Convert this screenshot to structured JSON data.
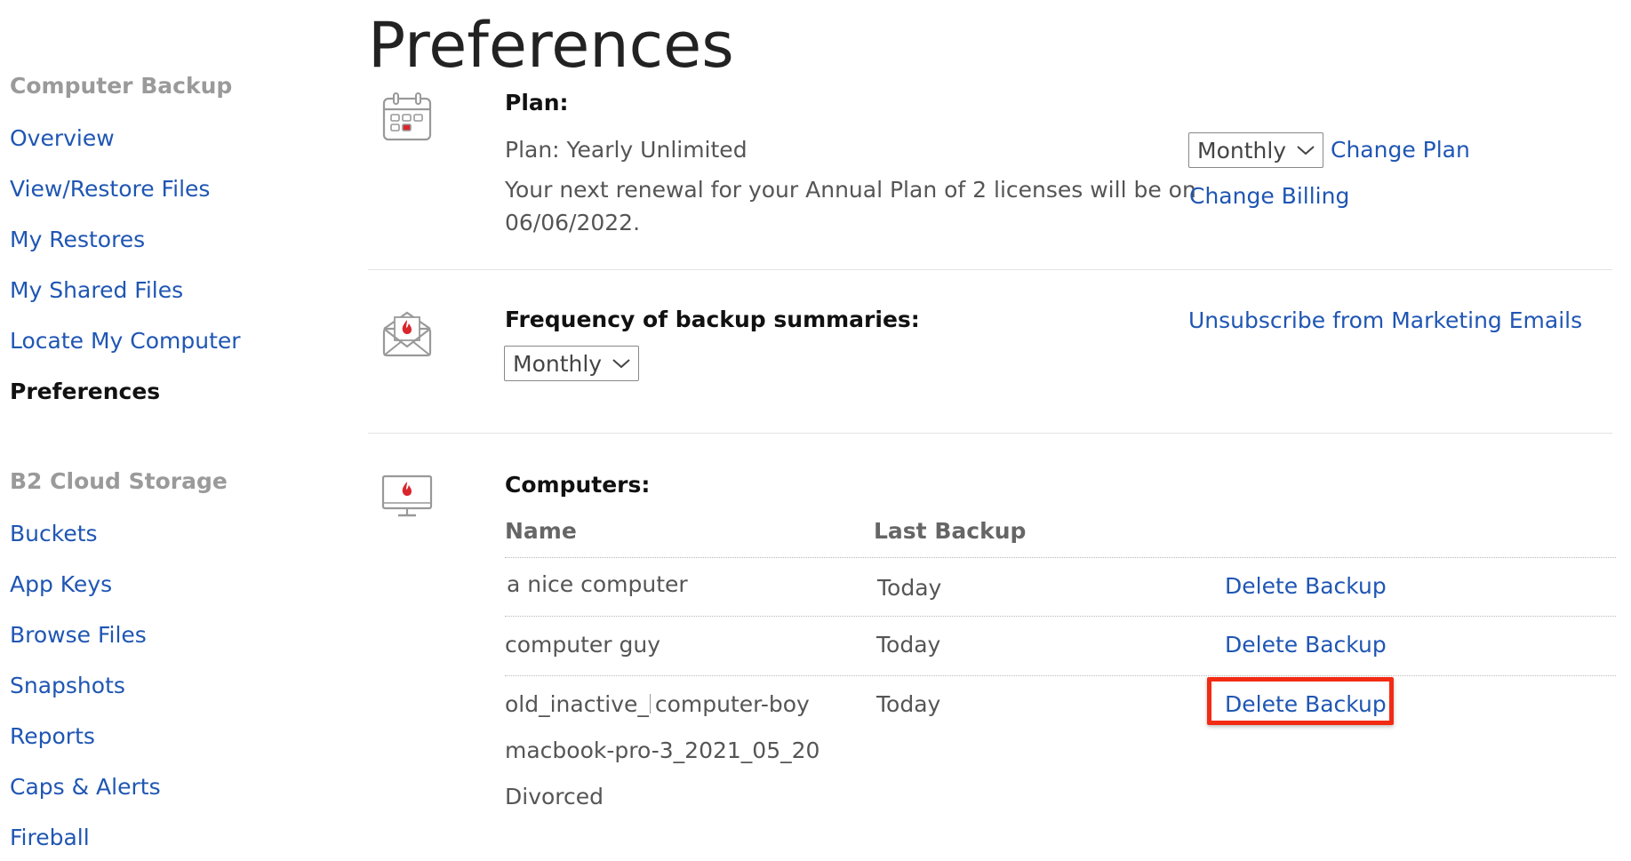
{
  "page": {
    "title": "Preferences"
  },
  "sidebar": {
    "computer_backup": {
      "title": "Computer Backup",
      "items": [
        {
          "label": "Overview"
        },
        {
          "label": "View/Restore Files"
        },
        {
          "label": "My Restores"
        },
        {
          "label": "My Shared Files"
        },
        {
          "label": "Locate My Computer"
        },
        {
          "label": "Preferences",
          "active": true
        }
      ]
    },
    "b2": {
      "title": "B2 Cloud Storage",
      "items": [
        {
          "label": "Buckets"
        },
        {
          "label": "App Keys"
        },
        {
          "label": "Browse Files"
        },
        {
          "label": "Snapshots"
        },
        {
          "label": "Reports"
        },
        {
          "label": "Caps & Alerts"
        },
        {
          "label": "Fireball"
        }
      ]
    }
  },
  "plan": {
    "icon": "calendar-icon",
    "heading": "Plan:",
    "plan_text": "Plan: Yearly Unlimited",
    "renewal_line1": "Your next renewal for your Annual Plan of 2 licenses will be on",
    "renewal_line2": "06/06/2022.",
    "billing_cycle_selected": "Monthly",
    "change_plan_label": "Change Plan",
    "change_billing_label": "Change Billing"
  },
  "frequency": {
    "icon": "mail-flame-icon",
    "heading": "Frequency of backup summaries:",
    "selected": "Monthly",
    "unsubscribe_label": "Unsubscribe from Marketing Emails"
  },
  "computers": {
    "icon": "monitor-flame-icon",
    "heading": "Computers:",
    "columns": {
      "name": "Name",
      "last_backup": "Last Backup"
    },
    "rows": [
      {
        "name": "a nice computer",
        "last_backup": "Today",
        "action": "Delete Backup"
      },
      {
        "name": "computer guy",
        "last_backup": "Today",
        "action": "Delete Backup"
      },
      {
        "name_part1": "old_inactive_",
        "name_part2": "computer-boy",
        "name_line2": "macbook-pro-3_2021_05_20",
        "name_line3": "Divorced",
        "last_backup": "Today",
        "action": "Delete Backup"
      }
    ]
  },
  "colors": {
    "link": "#1f56b3",
    "highlight": "#f32b13",
    "brand_red": "#d9262d"
  }
}
